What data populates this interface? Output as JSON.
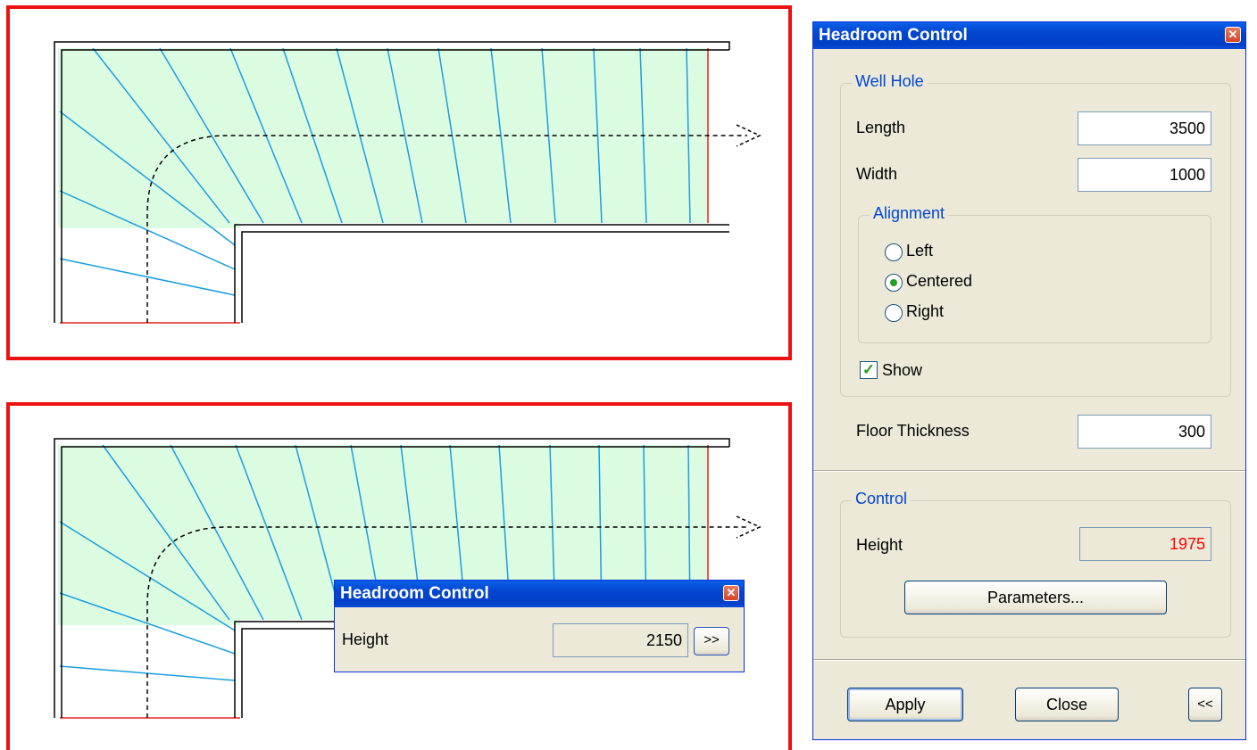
{
  "main_dialog": {
    "title": "Headroom Control",
    "well_hole": {
      "legend": "Well Hole",
      "length_label": "Length",
      "length_value": "3500",
      "width_label": "Width",
      "width_value": "1000",
      "alignment": {
        "legend": "Alignment",
        "options": [
          "Left",
          "Centered",
          "Right"
        ],
        "selected": "Centered"
      },
      "show_label": "Show",
      "show_checked": true
    },
    "floor_thickness_label": "Floor Thickness",
    "floor_thickness_value": "300",
    "control": {
      "legend": "Control",
      "height_label": "Height",
      "height_value": "1975",
      "height_color": "#ff0000",
      "parameters_button": "Parameters..."
    },
    "apply_button": "Apply",
    "close_button": "Close",
    "collapse_button": "<<"
  },
  "mini_dialog": {
    "title": "Headroom Control",
    "height_label": "Height",
    "height_value": "2150",
    "expand_button": ">>"
  },
  "colors": {
    "frame": "#ee1111",
    "stair_fill": "#dcfce1",
    "tread_line": "#1a9ee0",
    "accent": "#0046d5"
  }
}
